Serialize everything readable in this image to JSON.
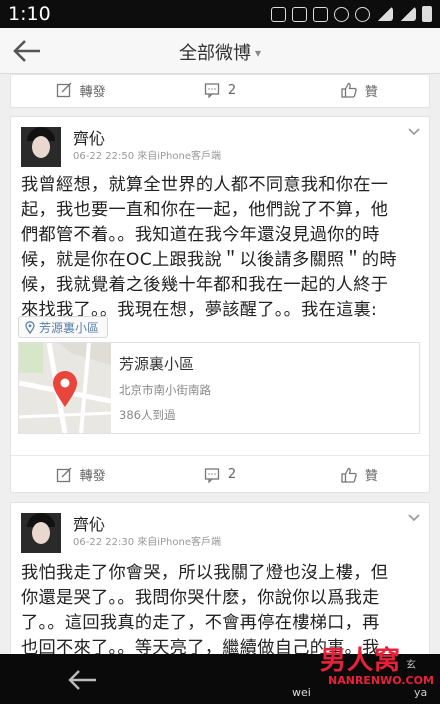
{
  "status_bar": {
    "time": "1:10"
  },
  "nav": {
    "title": "全部微博"
  },
  "actions": {
    "repost": "轉發",
    "comments": "2",
    "like": "贊"
  },
  "posts": [
    {
      "username": "齊伈",
      "meta": "06-22 22:50  來自iPhone客戶端",
      "lines": [
        "我曾經想，就算全世界的人都不同意我和你在一",
        "起，我也要一直和你在一起，他們說了不算，他",
        "們都管不着。。我知道在我今年還沒見過你的時",
        "候，就是你在OC上跟我說＂以後請多關照＂的時",
        "候，我就覺着之後幾十年都和我在一起的人終于",
        "來找我了。。我現在想，夢該醒了。。我在這裏:"
      ],
      "location_tag": "芳源裏小區",
      "location_card": {
        "name": "芳源裏小區",
        "address": "北京市南小街南路",
        "visits": "386人到過"
      }
    },
    {
      "username": "齊伈",
      "meta": "06-22 22:30  來自iPhone客戶端",
      "lines": [
        "我怕我走了你會哭，所以我關了燈也沒上樓，但",
        "你還是哭了。。我問你哭什麽，你說你以爲我走",
        "了。。這回我真的走了，不會再停在樓梯口，再",
        "也回不來了。。等天亮了，繼續做自己的事。我"
      ]
    }
  ],
  "watermark": {
    "big": "男人窝",
    "small": "NANRENWO.COM",
    "left": "wei",
    "right": "玄",
    "right2": "ya"
  },
  "colors": {
    "link_blue": "#5a7fa8",
    "pin_red": "#e8453c",
    "watermark_red": "#e8213b"
  }
}
